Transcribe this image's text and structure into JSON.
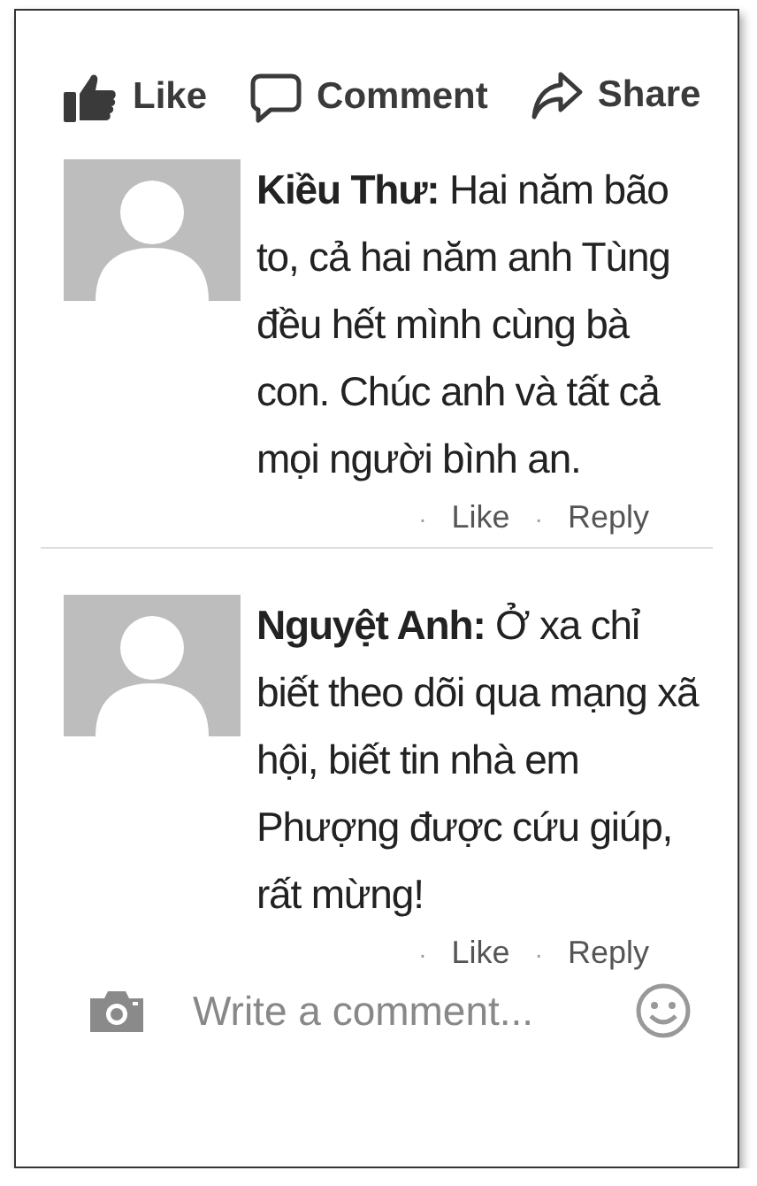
{
  "post_actions": [
    {
      "kind": "like",
      "label": "Like"
    },
    {
      "kind": "comment",
      "label": "Comment"
    },
    {
      "kind": "share",
      "label": "Share"
    }
  ],
  "comments": [
    {
      "text": "**Kiều Thư:** Hai năm bão to, cả hai năm anh Tùng đều hết mình cùng bà con. Chúc anh và tất cả mọi người bình an.",
      "actions": [
        {
          "dot": "·",
          "label": "Like"
        },
        {
          "dot": "·",
          "label": "Reply"
        }
      ]
    },
    {
      "text": "**Nguyệt Anh:** Ở xa chỉ biết theo dõi qua mạng xã hội, biết tin nhà em Phượng được cứu giúp, rất mừng!",
      "actions": [
        {
          "dot": "·",
          "label": "Like"
        },
        {
          "dot": "·",
          "label": "Reply"
        }
      ]
    }
  ],
  "composer": {
    "placeholder": "Write a comment..."
  }
}
